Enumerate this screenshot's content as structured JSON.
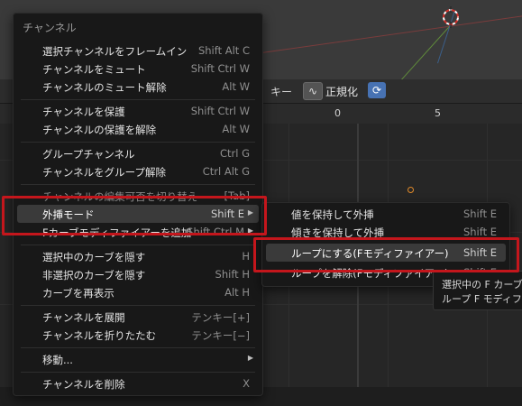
{
  "header": {
    "key_label": "キー",
    "normalize_label": "正規化",
    "normalize_icon": "normalize-icon",
    "refresh_icon": "auto-normalize-icon"
  },
  "ruler": {
    "ticks": [
      "0",
      "5"
    ]
  },
  "menu": {
    "title": "チャンネル",
    "items": [
      {
        "label": "選択チャンネルをフレームイン",
        "shortcut": "Shift Alt C"
      },
      {
        "label": "チャンネルをミュート",
        "shortcut": "Shift Ctrl W"
      },
      {
        "label": "チャンネルのミュート解除",
        "shortcut": "Alt W"
      },
      {
        "label": "チャンネルを保護",
        "shortcut": "Shift Ctrl W"
      },
      {
        "label": "チャンネルの保護を解除",
        "shortcut": "Alt W"
      },
      {
        "label": "グループチャンネル",
        "shortcut": "Ctrl G"
      },
      {
        "label": "チャンネルをグループ解除",
        "shortcut": "Ctrl Alt G"
      },
      {
        "label": "チャンネルの編集可否を切り替え",
        "shortcut": "[Tab]"
      },
      {
        "label": "外挿モード",
        "shortcut": "Shift E"
      },
      {
        "label": "Fカーブモディファイアーを追加",
        "shortcut": "Shift Ctrl M"
      },
      {
        "label": "選択中のカーブを隠す",
        "shortcut": "H"
      },
      {
        "label": "非選択のカーブを隠す",
        "shortcut": "Shift H"
      },
      {
        "label": "カーブを再表示",
        "shortcut": "Alt H"
      },
      {
        "label": "チャンネルを展開",
        "shortcut": "テンキー[+]"
      },
      {
        "label": "チャンネルを折りたたむ",
        "shortcut": "テンキー[−]"
      },
      {
        "label": "移動...",
        "shortcut": ""
      },
      {
        "label": "チャンネルを削除",
        "shortcut": "X"
      }
    ]
  },
  "submenu": {
    "items": [
      {
        "label": "値を保持して外挿",
        "shortcut": "Shift E"
      },
      {
        "label": "傾きを保持して外挿",
        "shortcut": "Shift E"
      },
      {
        "label": "ループにする(Fモディファイアー)",
        "shortcut": "Shift E"
      },
      {
        "label": "ループを解除(Fモディファイアー)",
        "shortcut": "Shift E"
      }
    ]
  },
  "tooltip": {
    "line1": "選択中の F カーブ",
    "line2": "ループ F モディフ"
  },
  "colors": {
    "annotation_red": "#c4161c",
    "highlight": "#3a3a3a",
    "accent_blue": "#4772b3",
    "keyframe_orange": "#e08a2a"
  }
}
